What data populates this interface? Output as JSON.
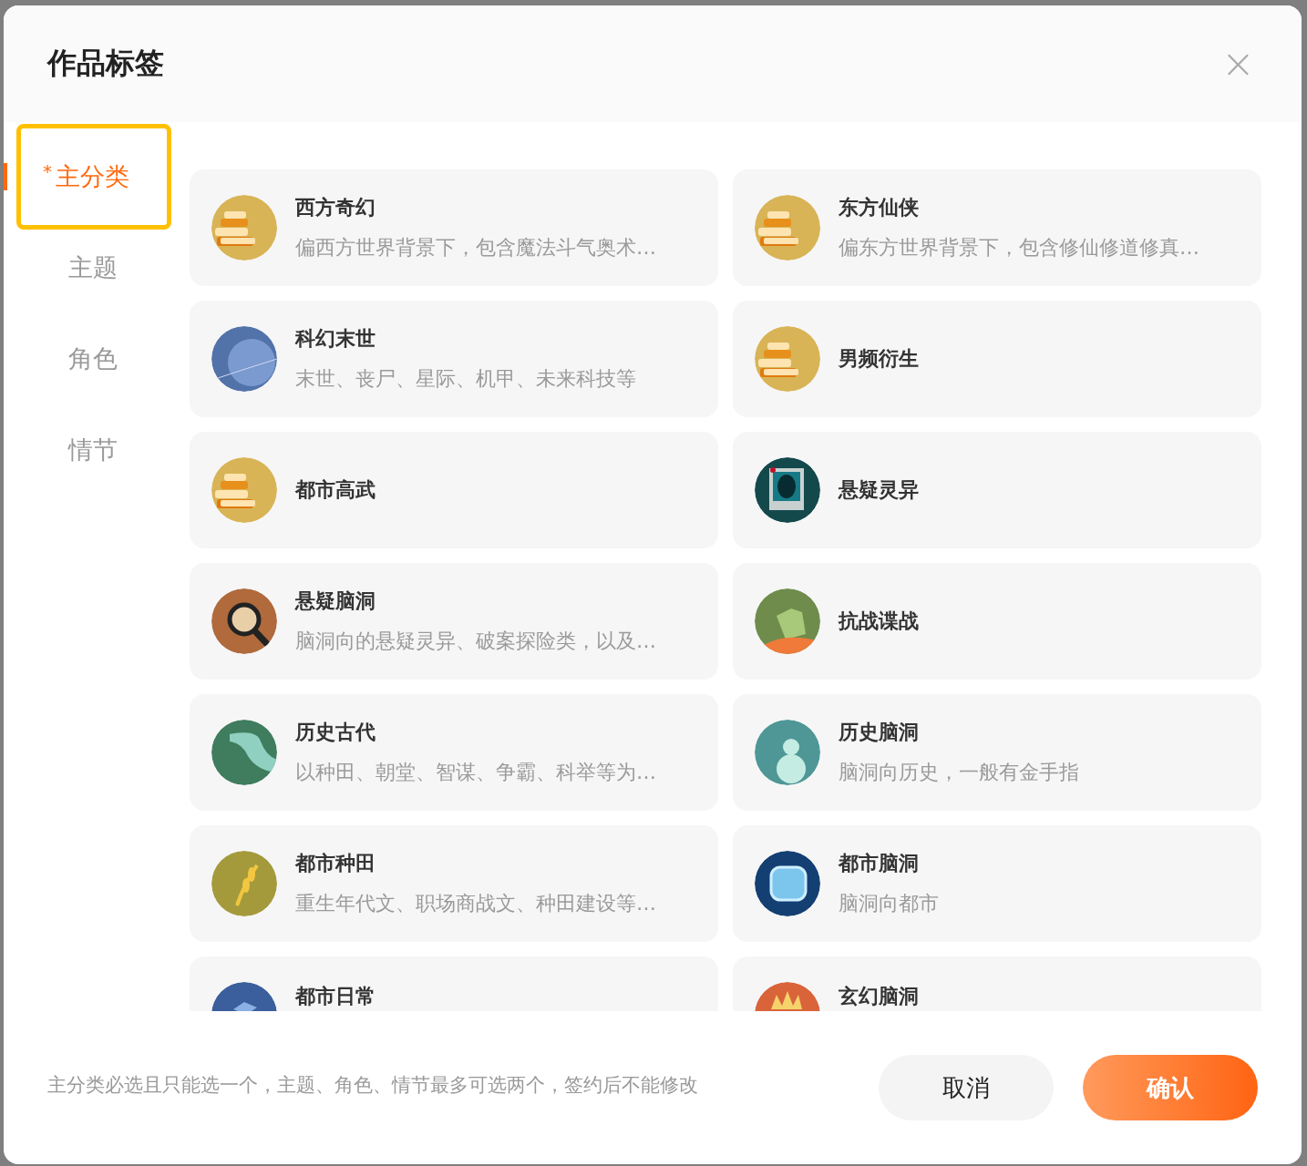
{
  "dialog": {
    "title": "作品标签",
    "close": "×"
  },
  "nav": [
    {
      "label": "主分类",
      "required_mark": "*",
      "selected": true
    },
    {
      "label": "主题",
      "selected": false
    },
    {
      "label": "角色",
      "selected": false
    },
    {
      "label": "情节",
      "selected": false
    }
  ],
  "categories": [
    {
      "title": "西方奇幻",
      "description": "偏西方世界背景下，包含魔法斗气奥术…",
      "kind": "books"
    },
    {
      "title": "东方仙侠",
      "description": "偏东方世界背景下，包含修仙修道修真…",
      "kind": "books"
    },
    {
      "title": "科幻末世",
      "description": "末世、丧尸、星际、机甲、未来科技等",
      "kind": "planet"
    },
    {
      "title": "男频衍生",
      "kind": "books"
    },
    {
      "title": "都市高武",
      "kind": "books"
    },
    {
      "title": "悬疑灵异",
      "kind": "photo"
    },
    {
      "title": "悬疑脑洞",
      "description": "脑洞向的悬疑灵异、破案探险类，以及…",
      "kind": "magnifier"
    },
    {
      "title": "抗战谍战",
      "kind": "bugler"
    },
    {
      "title": "历史古代",
      "description": "以种田、朝堂、智谋、争霸、科举等为…",
      "kind": "scroll"
    },
    {
      "title": "历史脑洞",
      "description": "脑洞向历史，一般有金手指",
      "kind": "gourd"
    },
    {
      "title": "都市种田",
      "description": "重生年代文、职场商战文、种田建设等…",
      "kind": "wheat"
    },
    {
      "title": "都市脑洞",
      "description": "脑洞向都市",
      "kind": "tv"
    },
    {
      "title": "都市日常",
      "kind": "cube",
      "clipped": true
    },
    {
      "title": "玄幻脑洞",
      "kind": "crown",
      "clipped": true
    }
  ],
  "footer": {
    "hint": "主分类必选且只能选一个，主题、角色、情节最多可选两个，签约后不能修改",
    "buttons": [
      {
        "label": "取消",
        "kind": "secondary"
      },
      {
        "label": "确认",
        "kind": "primary"
      }
    ]
  }
}
